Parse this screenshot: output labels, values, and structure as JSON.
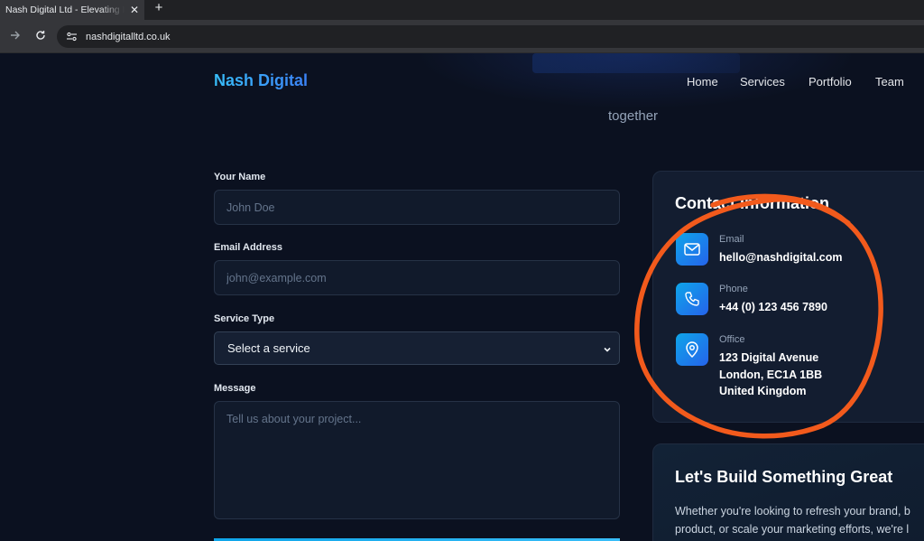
{
  "browser": {
    "tab_title": "Nash Digital Ltd - Elevating Digital Experiences",
    "tab_close": "✕",
    "new_tab": "+",
    "url": "nashdigitalltd.co.uk"
  },
  "header": {
    "brand": "Nash Digital",
    "nav": [
      "Home",
      "Services",
      "Portfolio",
      "Team"
    ]
  },
  "hero": {
    "tail_text": "together"
  },
  "form": {
    "name_label": "Your Name",
    "name_placeholder": "John Doe",
    "email_label": "Email Address",
    "email_placeholder": "john@example.com",
    "service_label": "Service Type",
    "service_selected": "Select a service",
    "message_label": "Message",
    "message_placeholder": "Tell us about your project..."
  },
  "contact": {
    "title": "Contact Information",
    "items": [
      {
        "icon": "mail-icon",
        "label": "Email",
        "value": "hello@nashdigital.com"
      },
      {
        "icon": "phone-icon",
        "label": "Phone",
        "value": "+44 (0) 123 456 7890"
      },
      {
        "icon": "map-pin-icon",
        "label": "Office",
        "lines": [
          "123 Digital Avenue",
          "London, EC1A 1BB",
          "United Kingdom"
        ]
      }
    ]
  },
  "cta": {
    "title": "Let's Build Something Great",
    "body_lines": [
      "Whether you're looking to refresh your brand, b",
      "product, or scale your marketing efforts, we're l"
    ]
  },
  "colors": {
    "background": "#0b1120",
    "brand_gradient_start": "#38bdf8",
    "brand_gradient_end": "#3b82f6",
    "annotation_stroke": "#f25a1c"
  }
}
